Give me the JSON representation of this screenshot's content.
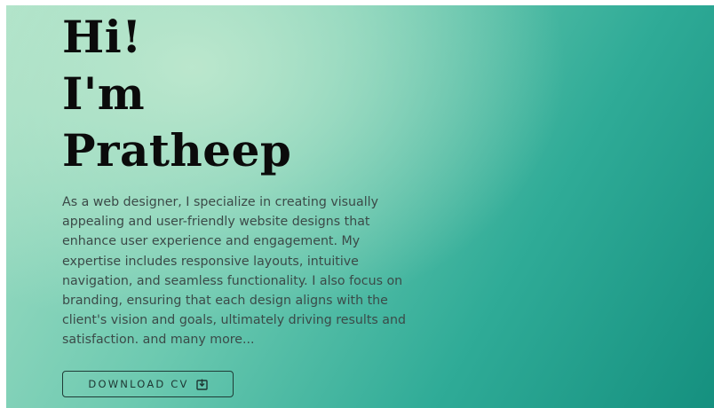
{
  "hero": {
    "greeting_line1": "Hi!",
    "greeting_line2": "I'm",
    "name": "Pratheep",
    "description": "As a web designer, I specialize in creating visually appealing and user-friendly website designs that enhance user experience and engagement. My expertise includes responsive layouts, intuitive navigation, and seamless functionality. I also focus on branding, ensuring that each design aligns with the client's vision and goals, ultimately driving results and satisfaction. and many more...",
    "download_button": {
      "label": "DOWNLOAD CV",
      "icon": "download-icon"
    }
  },
  "colors": {
    "heading_text": "#0b0b0b",
    "body_text": "#3b4a48",
    "gradient_light": "#bee8ce",
    "gradient_dark": "#15907f"
  }
}
